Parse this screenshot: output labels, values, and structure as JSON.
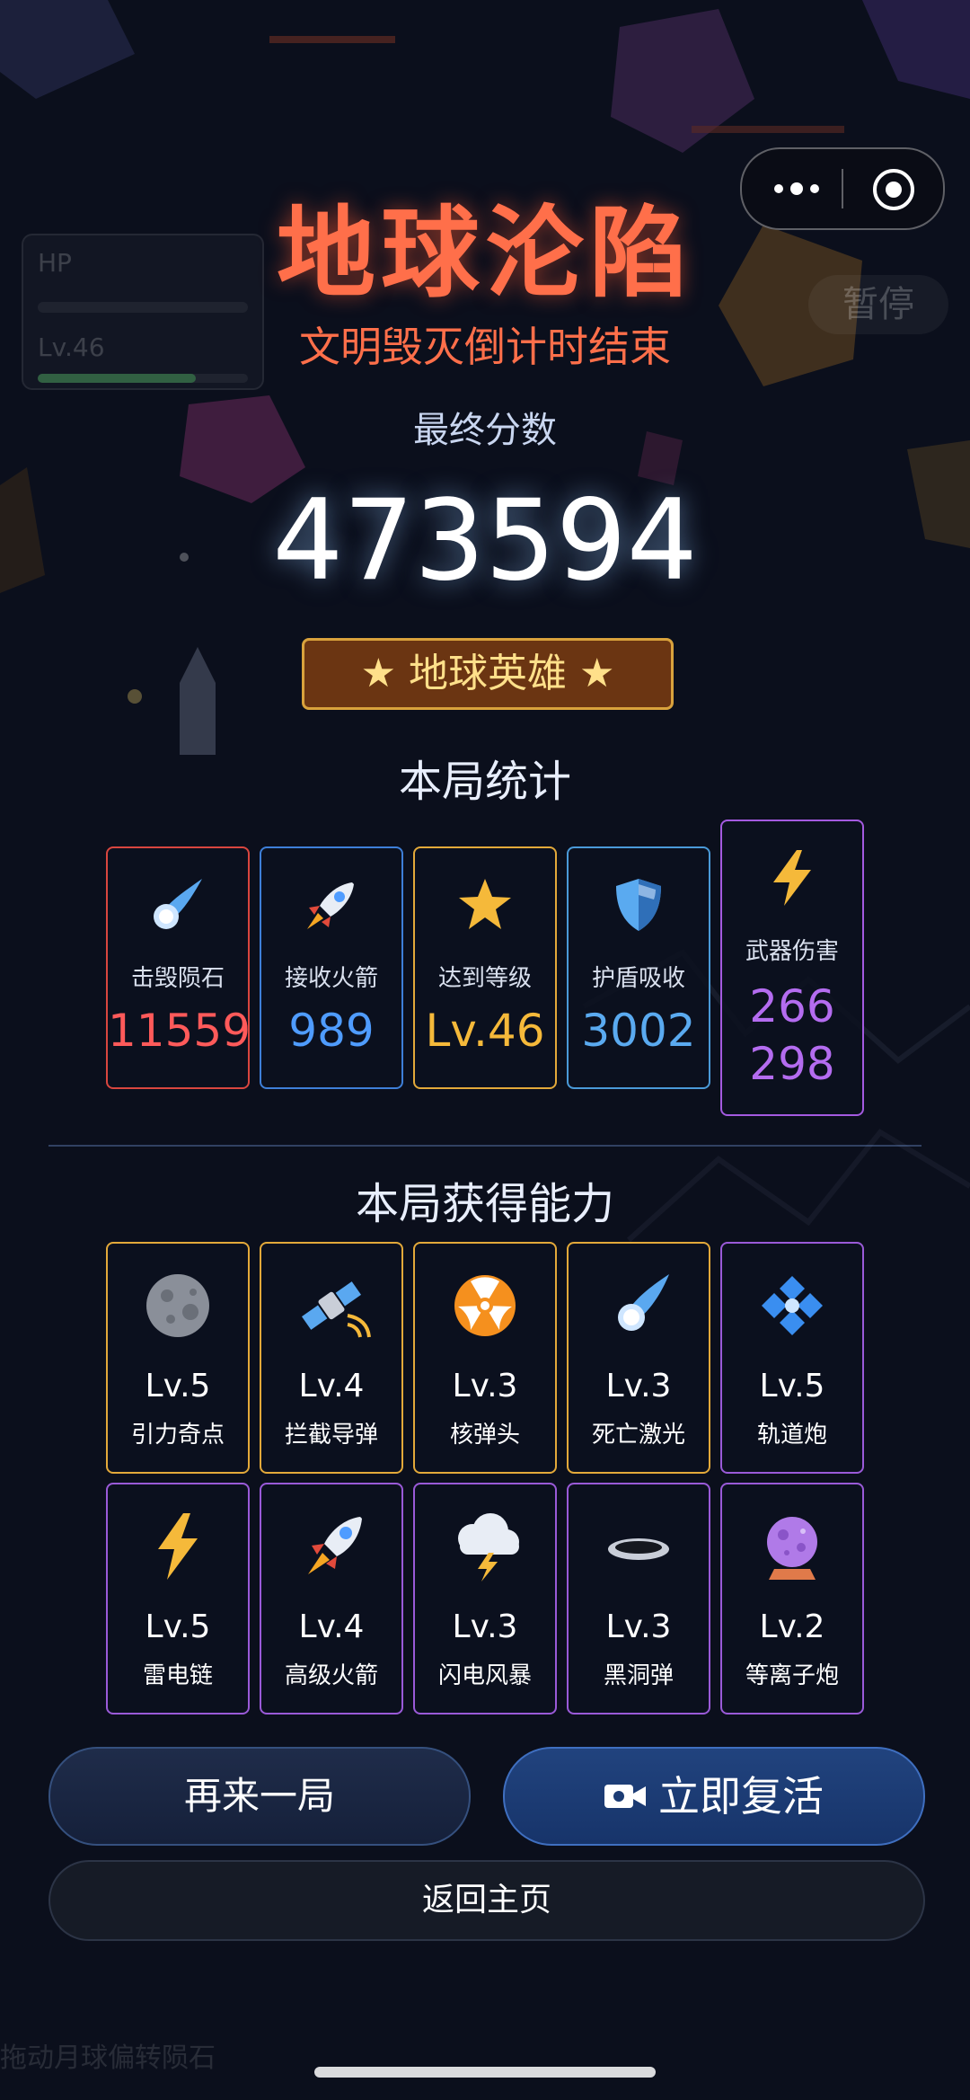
{
  "hud": {
    "hp_label": "HP",
    "level_label": "Lv.46",
    "hp_fraction": 0.0,
    "xp_fraction": 0.75
  },
  "pause_label": "暂停",
  "bottom_hint": "拖动月球偏转陨石",
  "game_over": {
    "title": "地球沦陷",
    "subtitle": "文明毁灭倒计时结束",
    "score_label": "最终分数",
    "score": "473594",
    "badge": "★ 地球英雄 ★"
  },
  "stats": {
    "title": "本局统计",
    "items": [
      {
        "icon": "comet-icon",
        "label": "击毁陨石",
        "value": "11559",
        "color": "#ff5a5a"
      },
      {
        "icon": "rocket-icon",
        "label": "接收火箭",
        "value": "989",
        "color": "#4f9cff"
      },
      {
        "icon": "star-icon",
        "label": "达到等级",
        "value": "Lv.46",
        "color": "#f5b93a"
      },
      {
        "icon": "shield-icon",
        "label": "护盾吸收",
        "value": "3002",
        "color": "#5aaaf0"
      },
      {
        "icon": "lightning-icon",
        "label": "武器伤害",
        "value": "266298",
        "value_line1": "266",
        "value_line2": "298",
        "color": "#b46cf0"
      }
    ]
  },
  "abilities": {
    "title": "本局获得能力",
    "items": [
      {
        "icon": "moon-icon",
        "level": "Lv.5",
        "name": "引力奇点",
        "tier_color": "#e3a93a"
      },
      {
        "icon": "satellite-icon",
        "level": "Lv.4",
        "name": "拦截导弹",
        "tier_color": "#e3a93a"
      },
      {
        "icon": "radiation-icon",
        "level": "Lv.3",
        "name": "核弹头",
        "tier_color": "#e3a93a"
      },
      {
        "icon": "comet-icon",
        "level": "Lv.3",
        "name": "死亡激光",
        "tier_color": "#e3a93a"
      },
      {
        "icon": "diamond-cluster-icon",
        "level": "Lv.5",
        "name": "轨道炮",
        "tier_color": "#9a5ad8"
      },
      {
        "icon": "lightning-icon",
        "level": "Lv.5",
        "name": "雷电链",
        "tier_color": "#9a5ad8"
      },
      {
        "icon": "rocket-icon",
        "level": "Lv.4",
        "name": "高级火箭",
        "tier_color": "#9a5ad8"
      },
      {
        "icon": "storm-cloud-icon",
        "level": "Lv.3",
        "name": "闪电风暴",
        "tier_color": "#9a5ad8"
      },
      {
        "icon": "black-hole-icon",
        "level": "Lv.3",
        "name": "黑洞弹",
        "tier_color": "#9a5ad8"
      },
      {
        "icon": "crystal-ball-icon",
        "level": "Lv.2",
        "name": "等离子炮",
        "tier_color": "#9a5ad8"
      }
    ]
  },
  "buttons": {
    "play_again": "再来一局",
    "revive": "立即复活",
    "home": "返回主页"
  }
}
